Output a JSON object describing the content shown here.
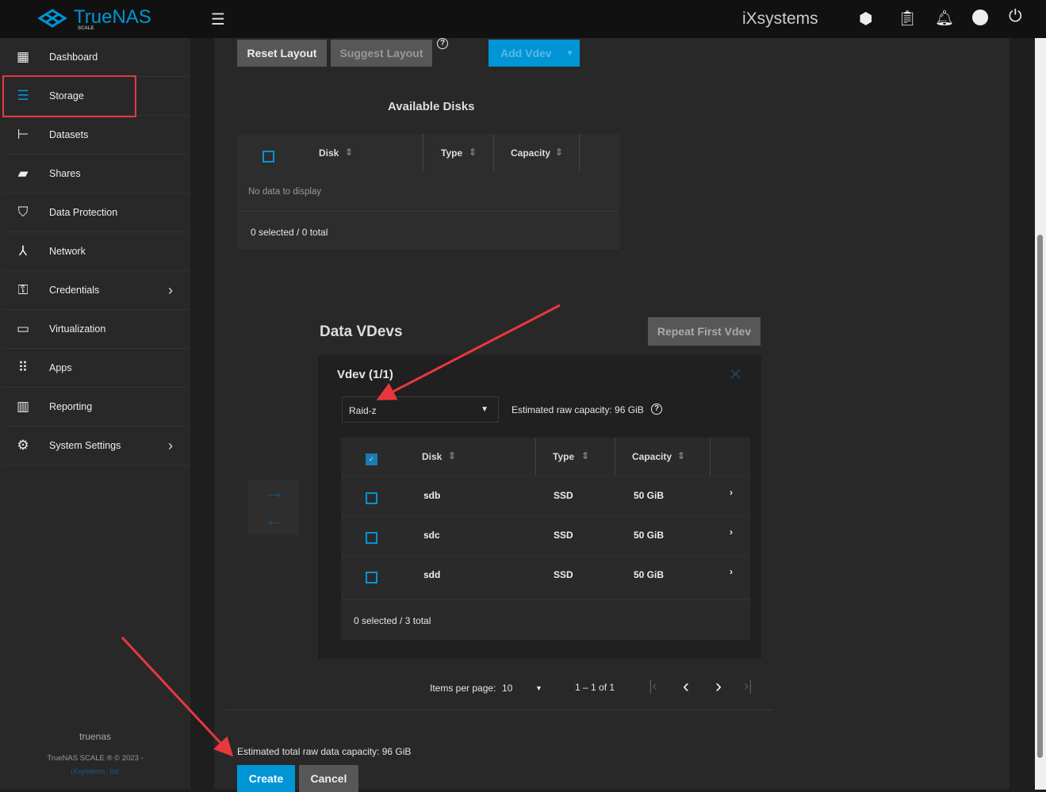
{
  "topbar": {
    "brand": "TrueNAS",
    "brand_sub": "SCALE",
    "vendor": "iXsystems",
    "icons": [
      "menu-icon",
      "truecommand-icon",
      "clipboard-icon",
      "bell-icon",
      "account-icon",
      "power-icon"
    ]
  },
  "sidebar": {
    "items": [
      {
        "label": "Dashboard",
        "icon": "dashboard-icon"
      },
      {
        "label": "Storage",
        "icon": "storage-icon",
        "highlighted": true
      },
      {
        "label": "Datasets",
        "icon": "datasets-icon"
      },
      {
        "label": "Shares",
        "icon": "shares-icon"
      },
      {
        "label": "Data Protection",
        "icon": "shield-icon"
      },
      {
        "label": "Network",
        "icon": "network-icon"
      },
      {
        "label": "Credentials",
        "icon": "key-icon",
        "has_submenu": true
      },
      {
        "label": "Virtualization",
        "icon": "laptop-icon"
      },
      {
        "label": "Apps",
        "icon": "apps-icon"
      },
      {
        "label": "Reporting",
        "icon": "reporting-icon"
      },
      {
        "label": "System Settings",
        "icon": "gear-icon",
        "has_submenu": true
      }
    ],
    "hostname": "truenas",
    "copyright": "TrueNAS SCALE ® © 2023 -",
    "company": "iXsystems, Inc"
  },
  "toolbar": {
    "reset": "Reset Layout",
    "suggest": "Suggest Layout",
    "add_vdev": "Add Vdev"
  },
  "available": {
    "title": "Available Disks",
    "columns": [
      "Disk",
      "Type",
      "Capacity"
    ],
    "empty": "No data to display",
    "footer": "0 selected / 0 total"
  },
  "vdevs": {
    "title": "Data VDevs",
    "repeat": "Repeat First Vdev",
    "vdev_title": "Vdev (1/1)",
    "layout": "Raid-z",
    "est": "Estimated raw capacity: 96 GiB",
    "columns": [
      "Disk",
      "Type",
      "Capacity"
    ],
    "rows": [
      {
        "disk": "sdb",
        "type": "SSD",
        "capacity": "50 GiB"
      },
      {
        "disk": "sdc",
        "type": "SSD",
        "capacity": "50 GiB"
      },
      {
        "disk": "sdd",
        "type": "SSD",
        "capacity": "50 GiB"
      }
    ],
    "footer": "0 selected / 3 total"
  },
  "paginator": {
    "label": "Items per page:",
    "size": "10",
    "range": "1 – 1 of 1"
  },
  "footer": {
    "total": "Estimated total raw data capacity: 96 GiB",
    "create": "Create",
    "cancel": "Cancel"
  },
  "colors": {
    "accent": "#0095d5",
    "annotation": "#e8383d"
  }
}
